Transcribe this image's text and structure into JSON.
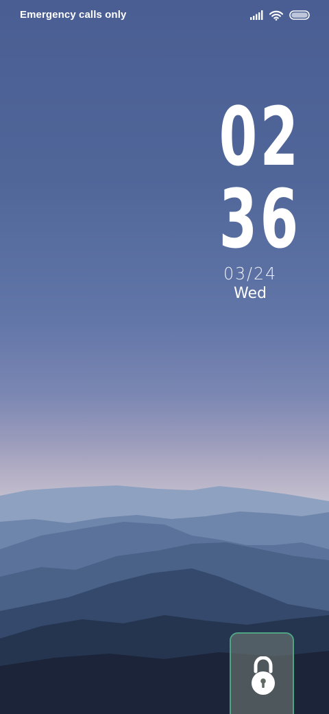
{
  "status_bar": {
    "carrier_text": "Emergency calls only",
    "icons": [
      "signal-icon",
      "wifi-icon",
      "battery-icon"
    ]
  },
  "clock": {
    "hour": "02",
    "minute": "36",
    "date": "03/24",
    "day": "Wed"
  },
  "unlock": {
    "icon": "lock-icon"
  },
  "colors": {
    "sky_top": "#4a5e93",
    "horizon": "#c2bfcf",
    "unlock_border": "#4fa484"
  }
}
